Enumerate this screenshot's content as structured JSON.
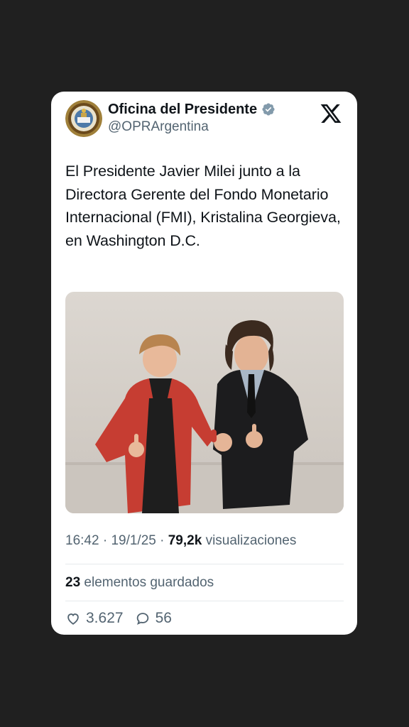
{
  "author": {
    "display_name": "Oficina del Presidente",
    "handle": "@OPRArgentina",
    "verified_icon": "verified-badge-icon",
    "platform_icon": "x-logo-icon"
  },
  "tweet": {
    "text": "El Presidente Javier Milei junto a la Directora Gerente del Fondo Monetario Internacional (FMI), Kristalina Georgieva, en Washington D.C.",
    "time": "16:42",
    "date": "19/1/25",
    "sep": "·",
    "views_count": "79,2k",
    "views_label": "visualizaciones"
  },
  "bookmarks": {
    "count": "23",
    "label": "elementos guardados"
  },
  "actions": {
    "likes": "3.627",
    "replies": "56"
  },
  "colors": {
    "background": "#202020",
    "card": "#ffffff",
    "text_primary": "#0f1419",
    "text_secondary": "#536471",
    "verified": "#829aab"
  }
}
